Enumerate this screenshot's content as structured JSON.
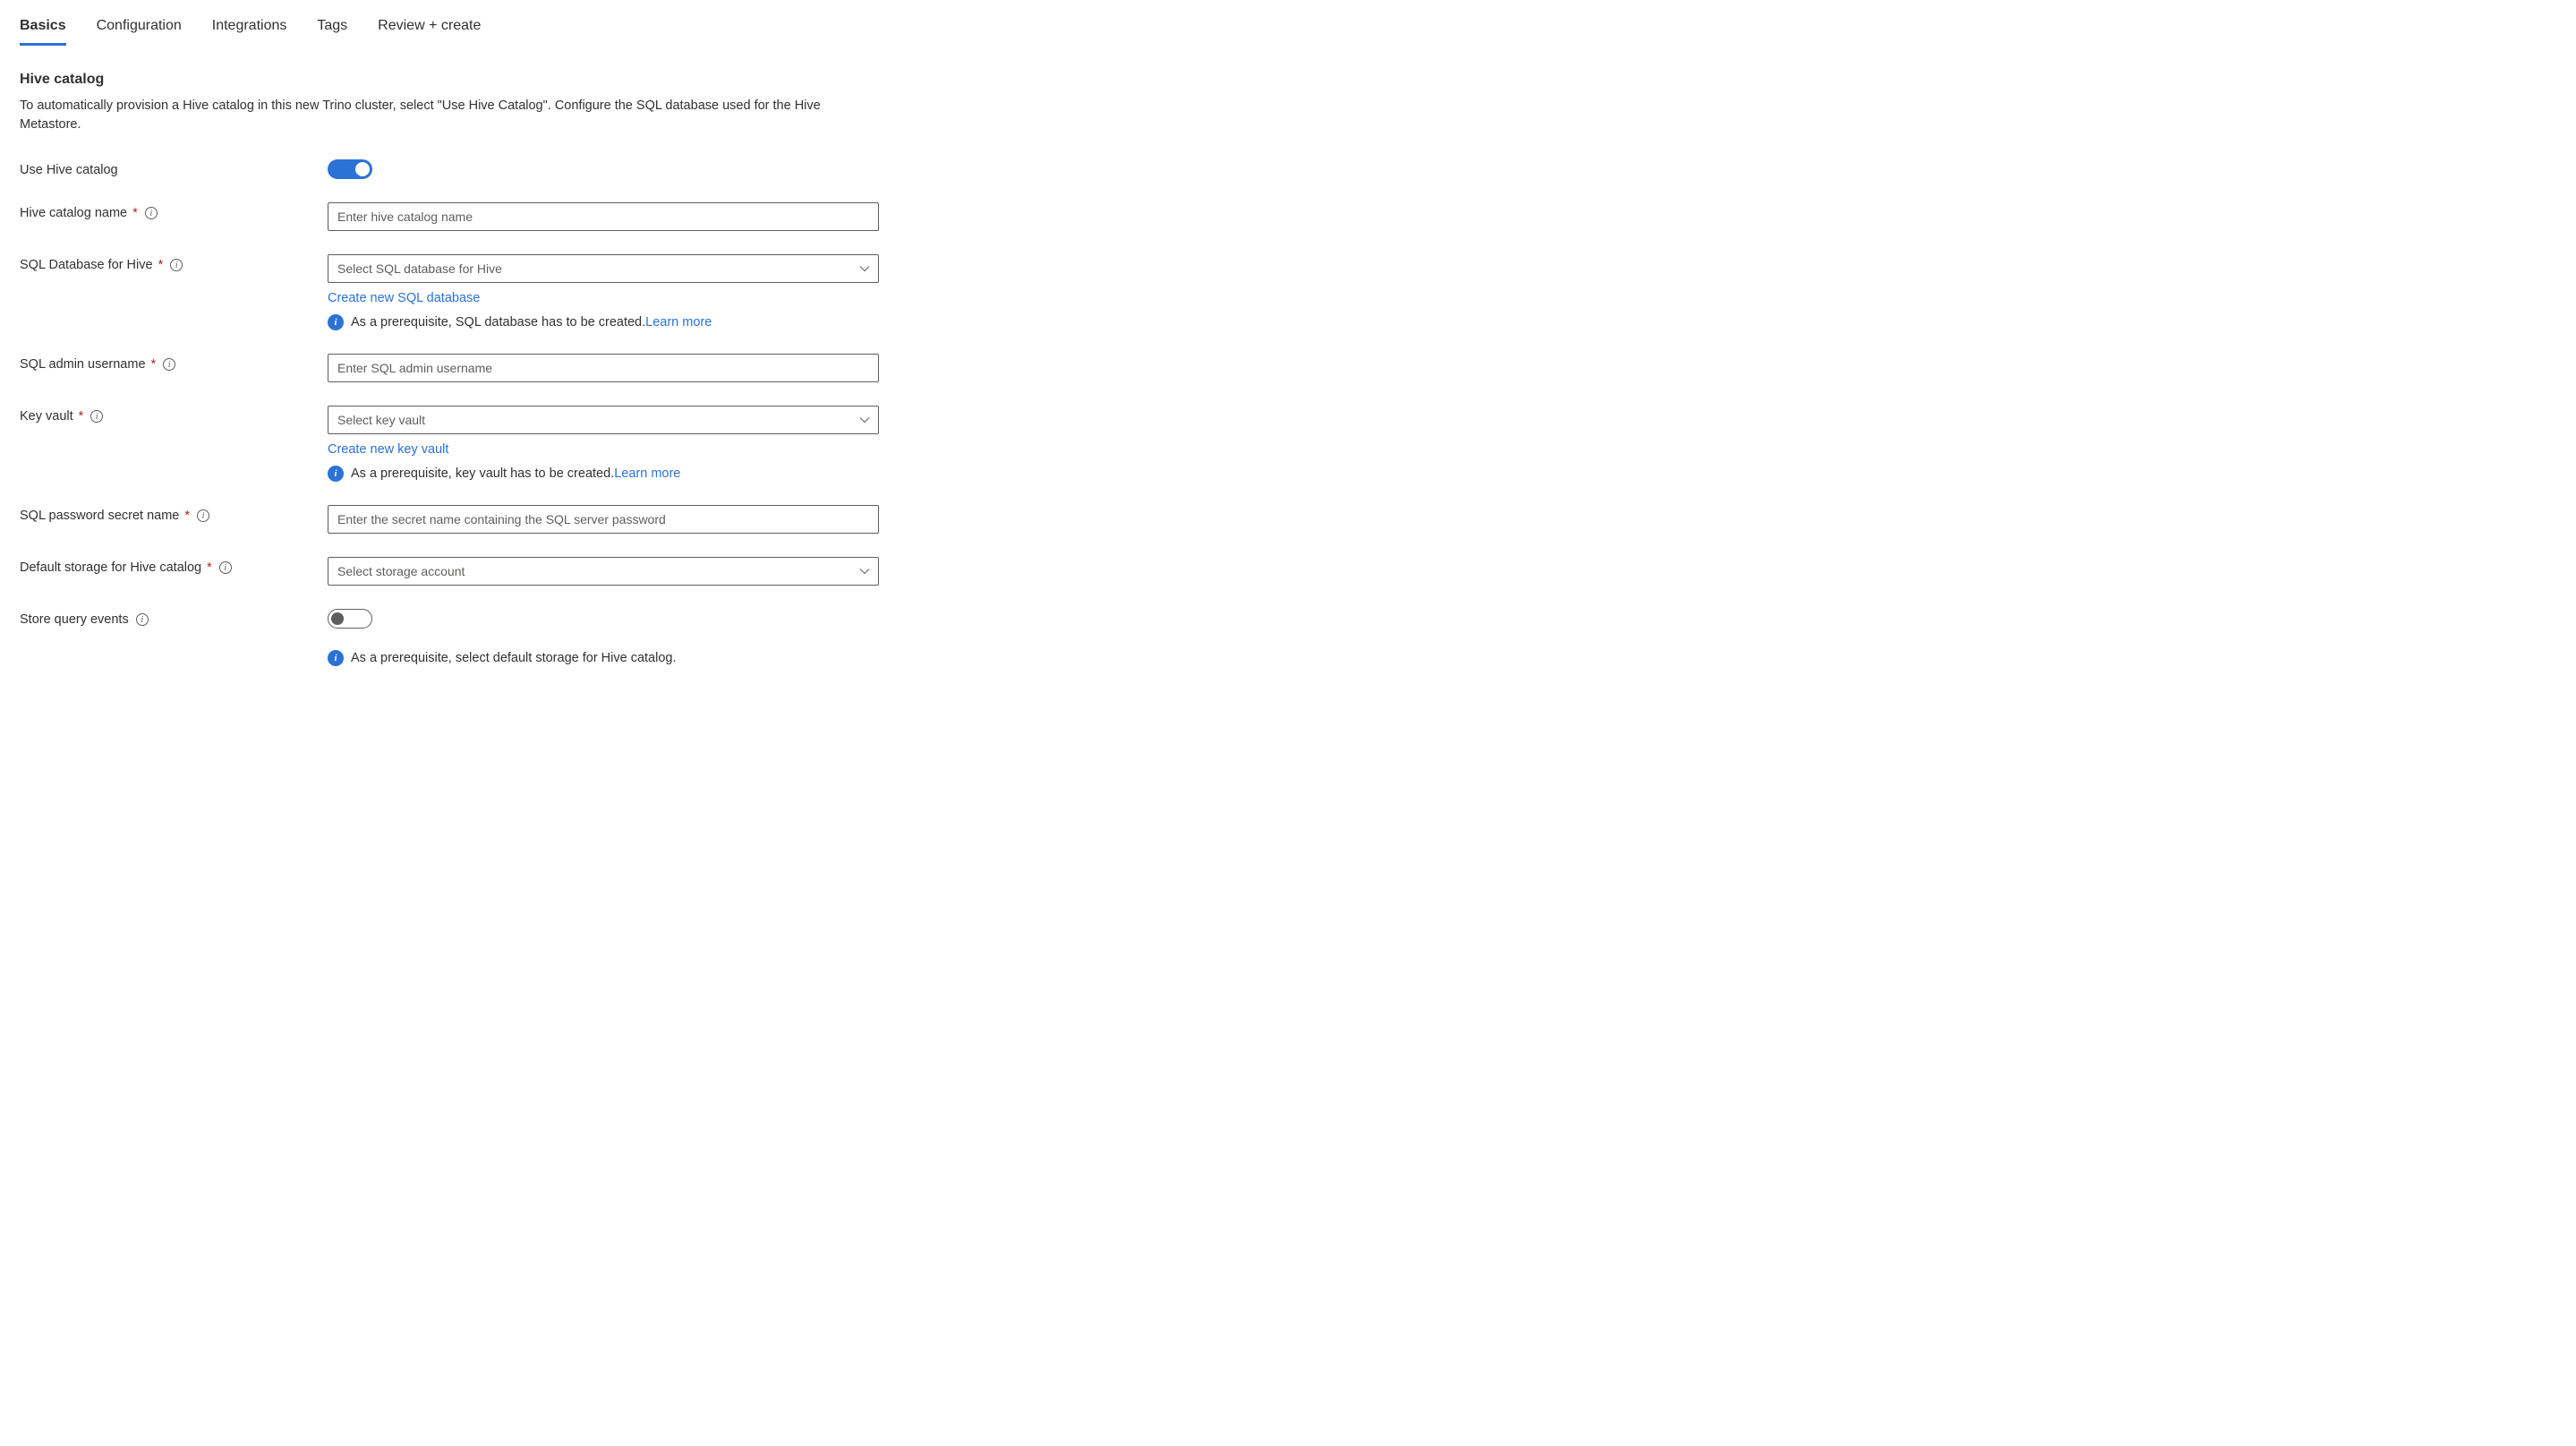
{
  "tabs": {
    "basics": "Basics",
    "configuration": "Configuration",
    "integrations": "Integrations",
    "tags": "Tags",
    "review": "Review + create"
  },
  "section": {
    "title": "Hive catalog",
    "description": "To automatically provision a Hive catalog in this new Trino cluster, select \"Use Hive Catalog\". Configure the SQL database used for the Hive Metastore."
  },
  "labels": {
    "use_hive": "Use Hive catalog",
    "catalog_name": "Hive catalog name",
    "sql_db": "SQL Database for Hive",
    "sql_admin": "SQL admin username",
    "key_vault": "Key vault",
    "sql_secret": "SQL password secret name",
    "default_storage": "Default storage for Hive catalog",
    "store_events": "Store query events"
  },
  "placeholders": {
    "catalog_name": "Enter hive catalog name",
    "sql_db": "Select SQL database for Hive",
    "sql_admin": "Enter SQL admin username",
    "key_vault": "Select key vault",
    "sql_secret": "Enter the secret name containing the SQL server password",
    "default_storage": "Select storage account"
  },
  "links": {
    "create_sql": "Create new SQL database",
    "create_kv": "Create new key vault",
    "learn_more": "Learn more"
  },
  "notes": {
    "sql_prereq": "As a prerequisite, SQL database has to be created.",
    "kv_prereq": "As a prerequisite, key vault has to be created.",
    "storage_prereq": "As a prerequisite, select default storage for Hive catalog."
  },
  "glyphs": {
    "info": "i"
  }
}
